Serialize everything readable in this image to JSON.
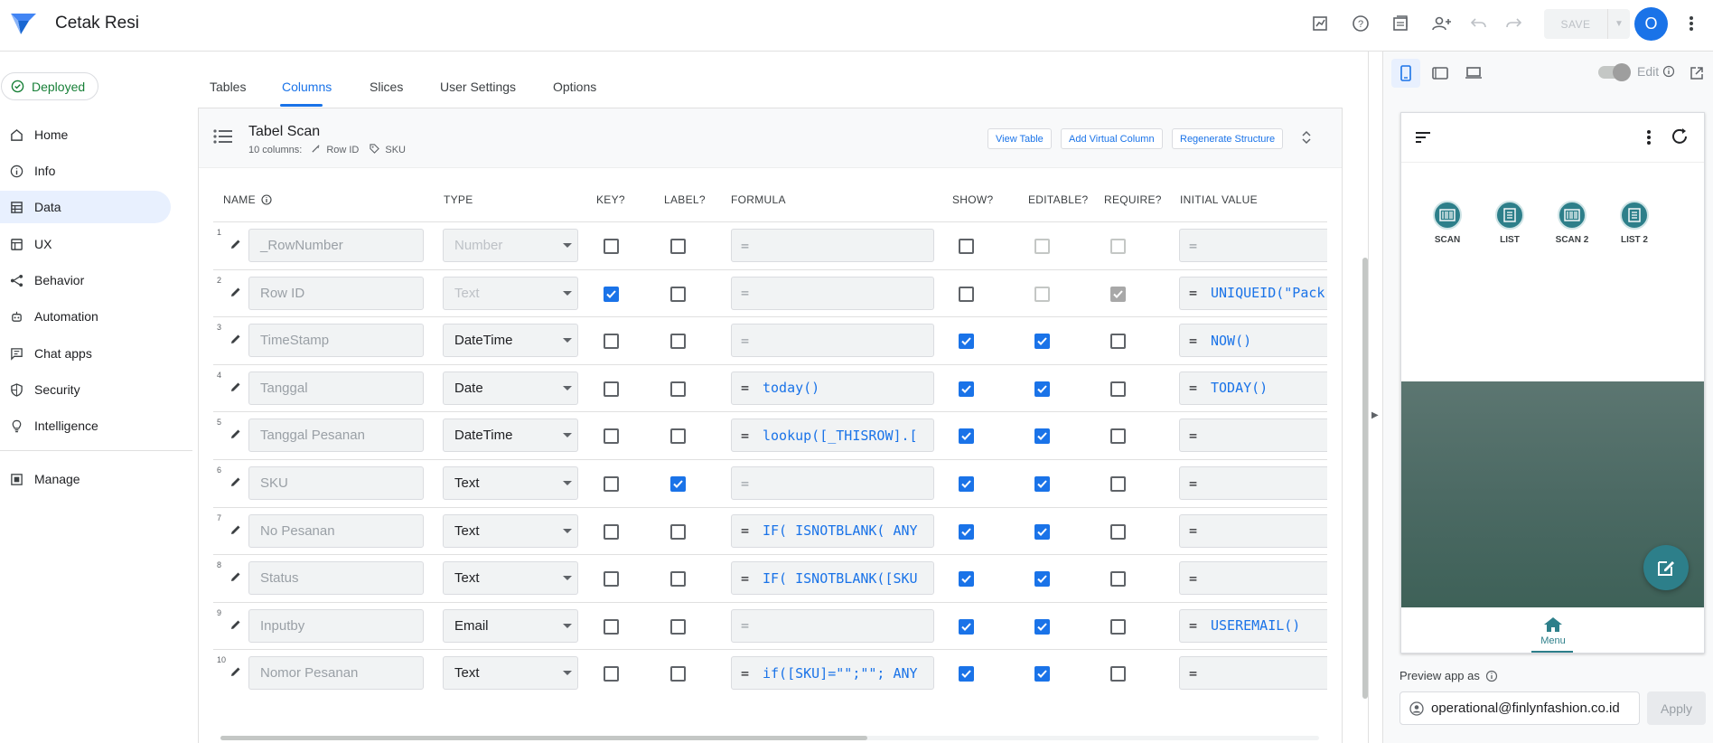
{
  "app": {
    "title": "Cetak Resi",
    "user_initial": "O",
    "save_label": "SAVE"
  },
  "status": {
    "label": "Deployed"
  },
  "sidebar": {
    "items": [
      {
        "label": "Home",
        "icon": "home-icon"
      },
      {
        "label": "Info",
        "icon": "info-icon"
      },
      {
        "label": "Data",
        "icon": "data-icon",
        "active": true
      },
      {
        "label": "UX",
        "icon": "ux-icon"
      },
      {
        "label": "Behavior",
        "icon": "behavior-icon"
      },
      {
        "label": "Automation",
        "icon": "automation-icon"
      },
      {
        "label": "Chat apps",
        "icon": "chat-icon"
      },
      {
        "label": "Security",
        "icon": "shield-icon"
      },
      {
        "label": "Intelligence",
        "icon": "bulb-icon"
      },
      {
        "label": "Manage",
        "icon": "manage-icon"
      }
    ]
  },
  "tabs": [
    {
      "label": "Tables"
    },
    {
      "label": "Columns",
      "active": true
    },
    {
      "label": "Slices"
    },
    {
      "label": "User Settings"
    },
    {
      "label": "Options"
    }
  ],
  "table": {
    "name": "Tabel Scan",
    "columns_count": "10 columns:",
    "key_label": "Row ID",
    "label_label": "SKU",
    "buttons": {
      "view": "View Table",
      "add_virtual": "Add Virtual Column",
      "regenerate": "Regenerate Structure"
    }
  },
  "headers": {
    "name": "NAME",
    "type": "TYPE",
    "key": "KEY?",
    "label": "LABEL?",
    "formula": "FORMULA",
    "show": "SHOW?",
    "editable": "EDITABLE?",
    "require": "REQUIRE?",
    "initial": "INITIAL VALUE"
  },
  "rows": [
    {
      "num": "1",
      "name": "_RowNumber",
      "type": "Number",
      "type_disabled": true,
      "key": false,
      "label": false,
      "formula": "",
      "show": false,
      "editable": "dis",
      "require": "dis",
      "initial": ""
    },
    {
      "num": "2",
      "name": "Row ID",
      "type": "Text",
      "type_disabled": true,
      "key": true,
      "label": false,
      "formula": "",
      "show": false,
      "editable": "dis",
      "require": "dis-on",
      "initial": "UNIQUEID(\"Pack"
    },
    {
      "num": "3",
      "name": "TimeStamp",
      "type": "DateTime",
      "type_disabled": false,
      "key": false,
      "label": false,
      "formula": "",
      "show": true,
      "editable": "on",
      "require": "off",
      "initial": "NOW()"
    },
    {
      "num": "4",
      "name": "Tanggal",
      "type": "Date",
      "type_disabled": false,
      "key": false,
      "label": false,
      "formula": "today()",
      "show": true,
      "editable": "on",
      "require": "off",
      "initial": "TODAY()"
    },
    {
      "num": "5",
      "name": "Tanggal Pesanan",
      "type": "DateTime",
      "type_disabled": false,
      "key": false,
      "label": false,
      "formula": "lookup([_THISROW].[",
      "show": true,
      "editable": "on",
      "require": "off",
      "initial": ""
    },
    {
      "num": "6",
      "name": "SKU",
      "type": "Text",
      "type_disabled": false,
      "key": false,
      "label": true,
      "formula": "",
      "show": true,
      "editable": "on",
      "require": "off",
      "initial": ""
    },
    {
      "num": "7",
      "name": "No Pesanan",
      "type": "Text",
      "type_disabled": false,
      "key": false,
      "label": false,
      "formula": "IF( ISNOTBLANK( ANY",
      "show": true,
      "editable": "on",
      "require": "off",
      "initial": ""
    },
    {
      "num": "8",
      "name": "Status",
      "type": "Text",
      "type_disabled": false,
      "key": false,
      "label": false,
      "formula": "IF( ISNOTBLANK([SKU",
      "show": true,
      "editable": "on",
      "require": "off",
      "initial": ""
    },
    {
      "num": "9",
      "name": "Inputby",
      "type": "Email",
      "type_disabled": false,
      "key": false,
      "label": false,
      "formula": "",
      "show": true,
      "editable": "on",
      "require": "off",
      "initial": "USEREMAIL()"
    },
    {
      "num": "10",
      "name": "Nomor Pesanan",
      "type": "Text",
      "type_disabled": false,
      "key": false,
      "label": false,
      "formula": "if([SKU]=\"\";\"\"; ANY",
      "show": true,
      "editable": "on",
      "require": "off",
      "initial": ""
    }
  ],
  "preview": {
    "edit_label": "Edit",
    "menu_tiles": [
      {
        "label": "SCAN"
      },
      {
        "label": "LIST"
      },
      {
        "label": "SCAN 2"
      },
      {
        "label": "LIST 2"
      }
    ],
    "bottom_nav_label": "Menu",
    "preview_as_label": "Preview app as",
    "email": "operational@finlynfashion.co.id",
    "apply_label": "Apply"
  },
  "colors": {
    "accent": "#1a73e8",
    "app_theme": "#2d7f8a",
    "deployed": "#188038"
  }
}
